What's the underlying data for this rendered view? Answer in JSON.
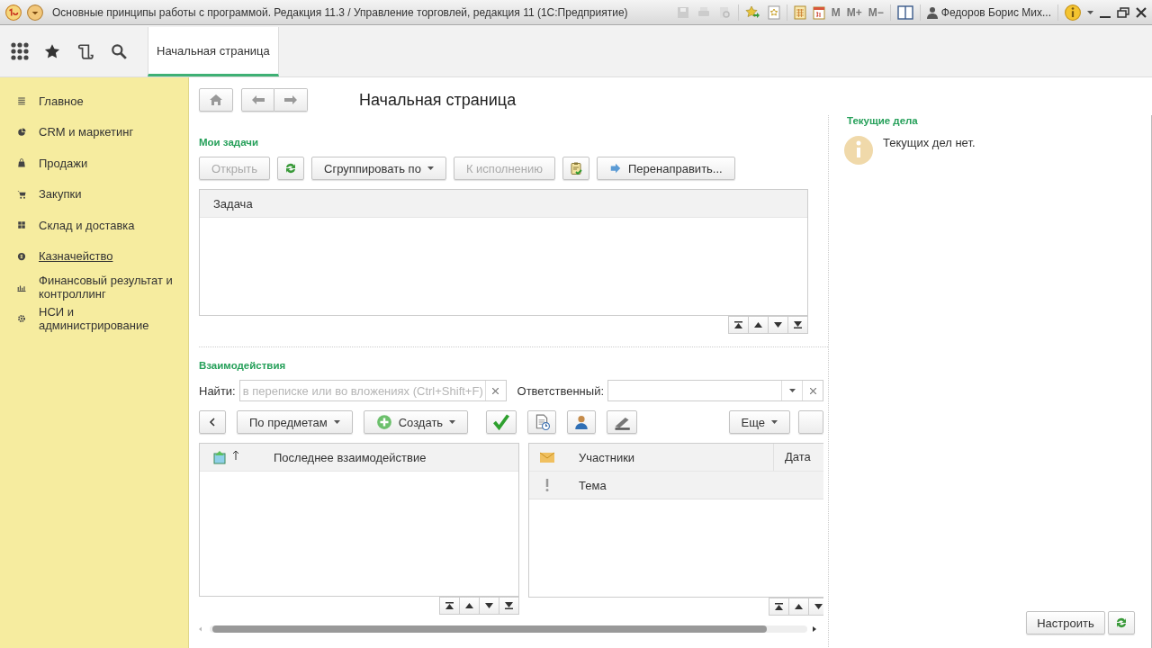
{
  "window": {
    "title": "Основные принципы работы с программой. Редакция 11.3 / Управление торговлей, редакция 11 (1С:Предприятие)",
    "memory_buttons": [
      "M",
      "M+",
      "M−"
    ],
    "user": "Федоров Борис Мих..."
  },
  "tabs": [
    {
      "label": "Начальная страница",
      "selected": true
    }
  ],
  "sidebar": {
    "items": [
      {
        "label": "Главное",
        "hovered": false
      },
      {
        "label": "CRM и маркетинг",
        "hovered": false
      },
      {
        "label": "Продажи",
        "hovered": false
      },
      {
        "label": "Закупки",
        "hovered": false
      },
      {
        "label": "Склад и доставка",
        "hovered": false
      },
      {
        "label": "Казначейство",
        "hovered": true
      },
      {
        "label": "Финансовый результат и контроллинг",
        "hovered": false
      },
      {
        "label": "НСИ и администрирование",
        "hovered": false
      }
    ]
  },
  "page": {
    "title": "Начальная страница"
  },
  "tasks": {
    "title": "Мои задачи",
    "buttons": [
      {
        "kind": "text",
        "label": "Открыть",
        "disabled": true
      },
      {
        "kind": "icon",
        "disabled": false
      },
      {
        "kind": "dropdown",
        "label": "Сгруппировать по",
        "disabled": false
      },
      {
        "kind": "text",
        "label": "К исполнению",
        "disabled": true
      },
      {
        "kind": "icon",
        "disabled": false
      },
      {
        "kind": "icon-text",
        "label": "Перенаправить...",
        "disabled": false
      }
    ],
    "columns": [
      "Задача"
    ]
  },
  "interactions": {
    "title": "Взаимодействия",
    "search": {
      "label": "Найти:",
      "placeholder": "в переписке или во вложениях (Ctrl+Shift+F)"
    },
    "responsible": {
      "label": "Ответственный:"
    },
    "buttons": [
      {
        "kind": "icon",
        "disabled": false
      },
      {
        "kind": "dropdown",
        "label": "По предметам",
        "disabled": false
      },
      {
        "kind": "icon-dropdown",
        "label": "Создать",
        "disabled": false
      },
      {
        "kind": "icon",
        "disabled": false
      },
      {
        "kind": "icon",
        "disabled": false
      },
      {
        "kind": "icon",
        "disabled": false
      },
      {
        "kind": "icon",
        "disabled": false
      },
      {
        "kind": "dropdown",
        "label": "Еще",
        "disabled": false
      }
    ],
    "subjects_columns": [
      "Последнее взаимодействие"
    ],
    "list_columns": [
      "Участники",
      "Дата"
    ],
    "list_subcolumns": [
      "Тема"
    ]
  },
  "current_tasks": {
    "title": "Текущие дела",
    "message": "Текущих дел нет.",
    "settings_button": "Настроить"
  }
}
